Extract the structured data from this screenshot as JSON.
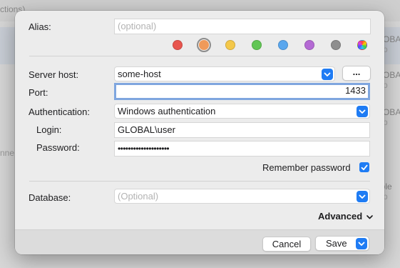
{
  "background": {
    "top_text": "ctions)",
    "side_rows": [
      {
        "line1": "GLOBAL",
        "line2": "d sp"
      },
      {
        "line1": "GLOBAL",
        "line2": "d sp"
      },
      {
        "line1": "GLOBAL",
        "line2": "d sp"
      },
      {
        "line1": "imple",
        "line2": "d sp"
      }
    ],
    "left_text": "nne"
  },
  "dialog": {
    "alias": {
      "label": "Alias:",
      "placeholder": "(optional)"
    },
    "colors": [
      "#e8554e",
      "#f09a5a",
      "#f4c84a",
      "#62c655",
      "#5aa7ee",
      "#b46ad4",
      "#8e8e8e",
      "rainbow"
    ],
    "selected_color_index": 1,
    "server_host": {
      "label": "Server host:",
      "value": "some-host",
      "browse_label": "..."
    },
    "port": {
      "label": "Port:",
      "value": "1433"
    },
    "authentication": {
      "label": "Authentication:",
      "value": "Windows authentication"
    },
    "login": {
      "label": "Login:",
      "value": "GLOBAL\\user"
    },
    "password": {
      "label": "Password:",
      "value": "••••••••••••••••••••"
    },
    "remember_password": {
      "label": "Remember password",
      "checked": true
    },
    "database": {
      "label": "Database:",
      "placeholder": "(Optional)"
    },
    "advanced_label": "Advanced",
    "cancel_label": "Cancel",
    "save_label": "Save"
  },
  "accent_color": "#1f7cf4"
}
